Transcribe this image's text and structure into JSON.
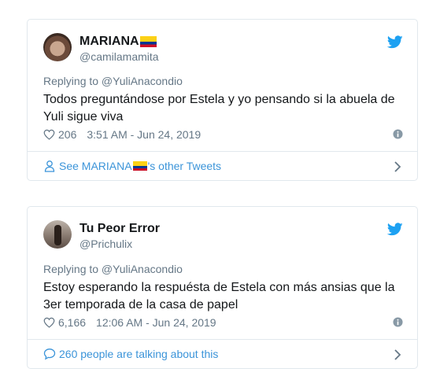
{
  "tweets": [
    {
      "display_name": "MARIANA",
      "handle": "@camilamamita",
      "replying_to": "Replying to @YuliAnacondio",
      "text": "Todos preguntándose por Estela y yo pensando si la abuela de Yuli sigue viva",
      "likes": "206",
      "timestamp": "3:51 AM - Jun 24, 2019",
      "footer_prefix": "See MARIANA",
      "footer_suffix": "'s other Tweets",
      "footer_icon": "person-icon"
    },
    {
      "display_name": "Tu Peor Error",
      "handle": "@Prichulix",
      "replying_to": "Replying to @YuliAnacondio",
      "text": "Estoy esperando la respuésta de Estela con más ansias que la 3er temporada de la casa de papel",
      "likes": "6,166",
      "timestamp": "12:06 AM - Jun 24, 2019",
      "footer_text": "260 people are talking about this",
      "footer_icon": "speech-bubble-icon"
    }
  ],
  "colors": {
    "link": "#3b94d9",
    "twitter_blue": "#1da1f2",
    "secondary_text": "#657786",
    "border": "#e1e8ed",
    "flag_yellow": "#fcd116",
    "flag_blue": "#003893",
    "flag_red": "#ce1126"
  }
}
